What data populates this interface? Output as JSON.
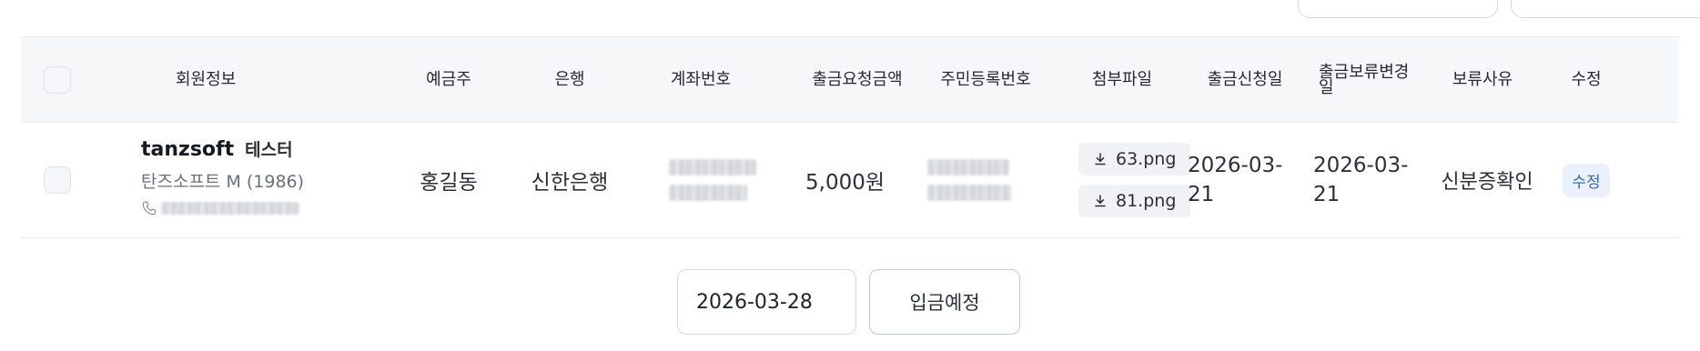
{
  "table": {
    "headers": {
      "member_info": "회원정보",
      "holder": "예금주",
      "bank": "은행",
      "account_no": "계좌번호",
      "amount": "출금요청금액",
      "resident_no": "주민등록번호",
      "attachments": "첨부파일",
      "request_date": "출금신청일",
      "hold_change_date": "출금보류변경일",
      "hold_reason": "보류사유",
      "edit": "수정"
    },
    "rows": [
      {
        "member_id": "tanzsoft",
        "nickname": "테스터",
        "member_detail": "탄즈소프트 M (1986)",
        "holder": "홍길동",
        "bank": "신한은행",
        "amount": "5,000원",
        "attachments": [
          "63.png",
          "81.png"
        ],
        "request_date": "2026-03-21",
        "hold_change_date": "2026-03-21",
        "hold_reason": "신분증확인",
        "edit_label": "수정"
      }
    ]
  },
  "footer": {
    "date_value": "2026-03-28",
    "deposit_button": "입금예정"
  },
  "colors": {
    "header_bg": "#f6f7f9",
    "edit_badge_text": "#3565b8",
    "edit_badge_bg": "#eaf1fb"
  }
}
